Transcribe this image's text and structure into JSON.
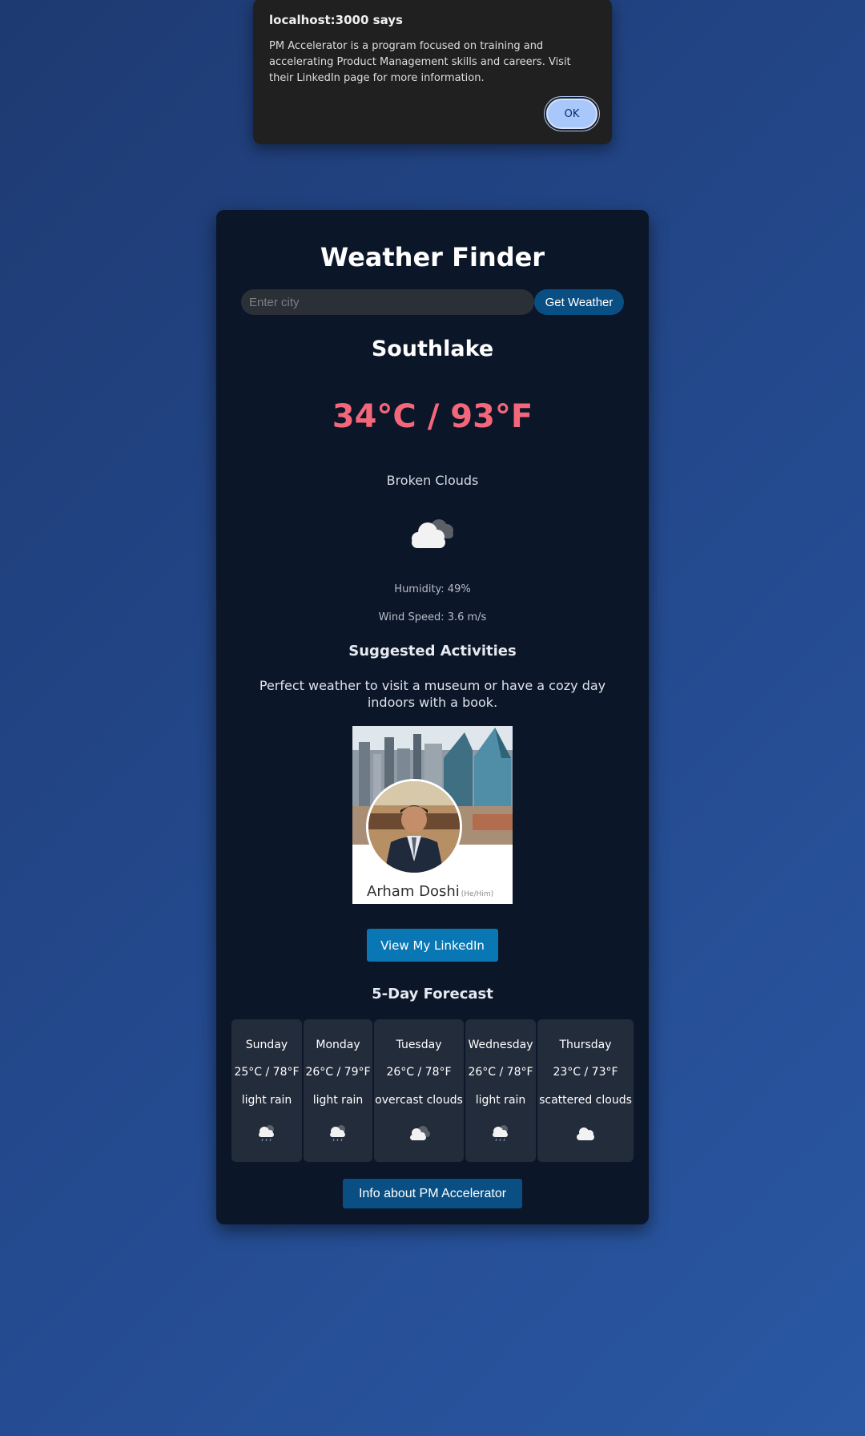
{
  "alert": {
    "title": "localhost:3000 says",
    "message": "PM Accelerator is a program focused on training and accelerating Product Management skills and careers. Visit their LinkedIn page for more information.",
    "ok_label": "OK"
  },
  "app": {
    "title": "Weather Finder",
    "search_placeholder": "Enter city",
    "search_value": "",
    "get_weather_label": "Get Weather"
  },
  "weather": {
    "city": "Southlake",
    "temperature": "34°C / 93°F",
    "description": "Broken Clouds",
    "icon": "broken-clouds-icon",
    "humidity": "Humidity: 49%",
    "wind": "Wind Speed: 3.6 m/s"
  },
  "activities": {
    "title": "Suggested Activities",
    "text": "Perfect weather to visit a museum or have a cozy day indoors with a book."
  },
  "profile": {
    "name": "Arham Doshi",
    "pronouns": "(He/Him)",
    "linkedin_label": "View My LinkedIn"
  },
  "forecast": {
    "title": "5-Day Forecast",
    "days": [
      {
        "day": "Sunday",
        "temp": "25°C / 78°F",
        "desc": "light rain",
        "icon": "light-rain-icon"
      },
      {
        "day": "Monday",
        "temp": "26°C / 79°F",
        "desc": "light rain",
        "icon": "light-rain-icon"
      },
      {
        "day": "Tuesday",
        "temp": "26°C / 78°F",
        "desc": "overcast clouds",
        "icon": "overcast-clouds-icon"
      },
      {
        "day": "Wednesday",
        "temp": "26°C / 78°F",
        "desc": "light rain",
        "icon": "light-rain-icon"
      },
      {
        "day": "Thursday",
        "temp": "23°C / 73°F",
        "desc": "scattered clouds",
        "icon": "scattered-clouds-icon"
      }
    ]
  },
  "footer": {
    "pm_button_label": "Info about PM Accelerator"
  },
  "colors": {
    "background": "#244a8f",
    "card": "#0c1629",
    "temperature": "#f4677a",
    "button": "#0a4f84",
    "linkedin": "#0a77b5",
    "alert_ok": "#a8c7fa"
  }
}
